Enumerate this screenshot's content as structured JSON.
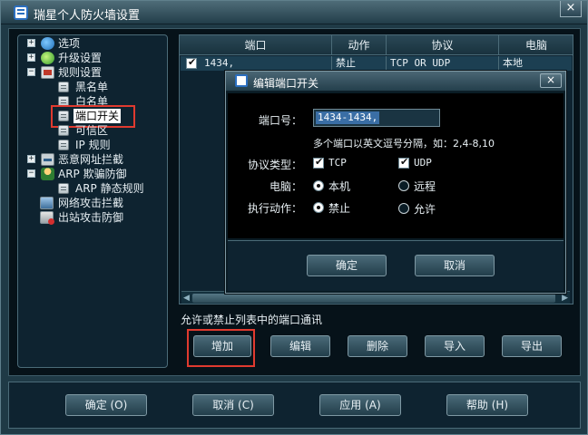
{
  "window": {
    "title": "瑞星个人防火墙设置",
    "close_label": "×"
  },
  "tree": {
    "items": [
      {
        "label": "选项",
        "icon": "options-icon",
        "expander": "+"
      },
      {
        "label": "升级设置",
        "icon": "upgrade-icon",
        "expander": "+"
      },
      {
        "label": "规则设置",
        "icon": "rules-icon",
        "expander": "−"
      },
      {
        "label": "黑名单",
        "icon": "page-icon"
      },
      {
        "label": "白名单",
        "icon": "page-icon"
      },
      {
        "label": "端口开关",
        "icon": "page-icon",
        "selected": true
      },
      {
        "label": "可信区",
        "icon": "page-icon"
      },
      {
        "label": "IP 规则",
        "icon": "page-icon"
      },
      {
        "label": "恶意网址拦截",
        "icon": "malicious-url-icon",
        "expander": "+"
      },
      {
        "label": "ARP 欺骗防御",
        "icon": "arp-icon",
        "expander": "−"
      },
      {
        "label": "ARP 静态规则",
        "icon": "page-icon"
      },
      {
        "label": "网络攻击拦截",
        "icon": "network-attack-icon"
      },
      {
        "label": "出站攻击防御",
        "icon": "outbound-icon"
      }
    ]
  },
  "port_table": {
    "columns": [
      "端口",
      "动作",
      "协议",
      "电脑"
    ],
    "rows": [
      {
        "checked": true,
        "port": "1434,",
        "action": "禁止",
        "protocol": "TCP OR UDP",
        "computer": "本地"
      }
    ]
  },
  "description": "允许或禁止列表中的端口通讯",
  "actions": {
    "add": "增加",
    "edit": "编辑",
    "delete": "删除",
    "import": "导入",
    "export": "导出"
  },
  "footer": {
    "ok": "确定 (O)",
    "cancel": "取消 (C)",
    "apply": "应用 (A)",
    "help": "帮助 (H)"
  },
  "dialog": {
    "title": "编辑端口开关",
    "close_label": "×",
    "port_label": "端口号：",
    "port_value": "1434-1434,",
    "hint": "多个端口以英文逗号分隔，如：2,4-8,10",
    "protocol_label": "协议类型：",
    "tcp_label": "TCP",
    "udp_label": "UDP",
    "computer_label": "电脑：",
    "local_label": "本机",
    "remote_label": "远程",
    "action_label": "执行动作：",
    "forbid_label": "禁止",
    "allow_label": "允许",
    "ok": "确定",
    "cancel": "取消"
  }
}
